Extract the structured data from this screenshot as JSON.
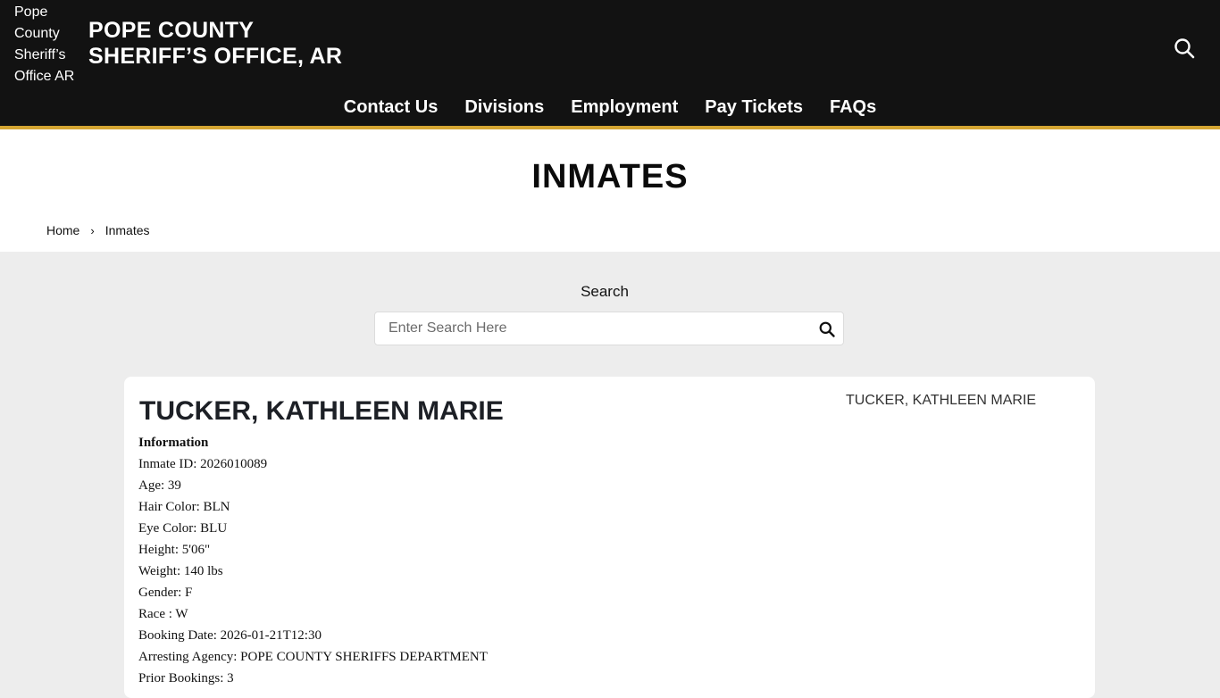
{
  "header": {
    "logo_alt": "Pope County Sheriff’s Office AR",
    "title_line1": "POPE COUNTY",
    "title_line2": "SHERIFF’S OFFICE, AR",
    "search_icon": "search-icon"
  },
  "nav": {
    "items": [
      "Contact Us",
      "Divisions",
      "Employment",
      "Pay Tickets",
      "FAQs"
    ]
  },
  "page": {
    "title": "INMATES"
  },
  "breadcrumb": {
    "home": "Home",
    "separator": "›",
    "current": "Inmates"
  },
  "search": {
    "label": "Search",
    "placeholder": "Enter Search Here",
    "value": ""
  },
  "inmate": {
    "name": "TUCKER, KATHLEEN MARIE",
    "photo_alt": "TUCKER, KATHLEEN MARIE",
    "info_heading": "Information",
    "fields": [
      "Inmate ID: 2026010089",
      "Age: 39",
      "Hair Color: BLN",
      "Eye Color: BLU",
      "Height: 5'06\"",
      "Weight: 140 lbs",
      "Gender: F",
      "Race : W",
      "Booking Date: 2026-01-21T12:30",
      "Arresting Agency: POPE COUNTY SHERIFFS DEPARTMENT",
      "Prior Bookings: 3"
    ]
  },
  "colors": {
    "header_bg": "#121212",
    "accent_gold": "#d4a532",
    "page_bg": "#ededed"
  }
}
